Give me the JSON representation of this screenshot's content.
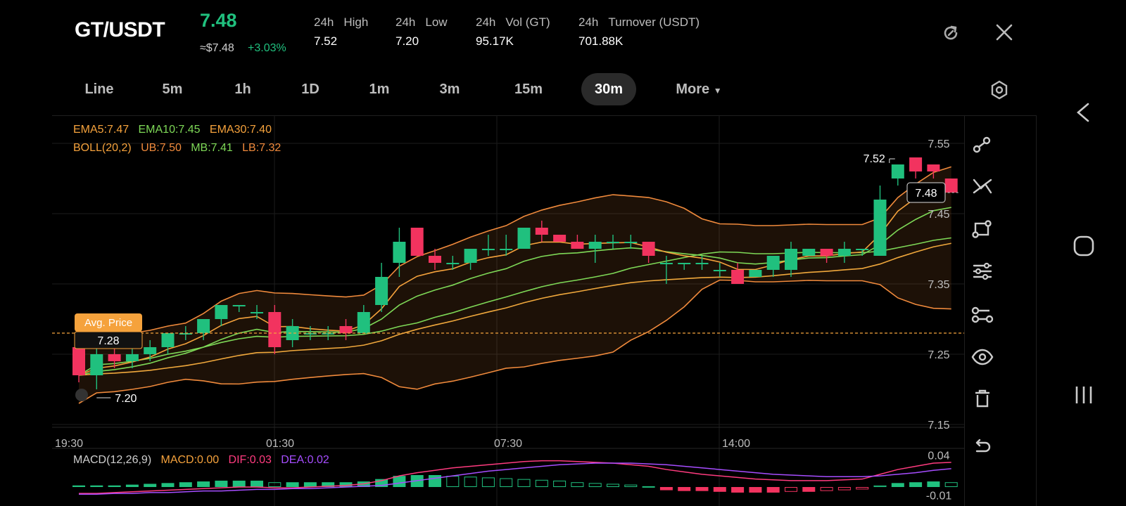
{
  "header": {
    "pair": "GT/USDT",
    "last_price": "7.48",
    "approx_usd": "≈$7.48",
    "change_pct": "+3.03%",
    "stats": [
      {
        "label_a": "24h",
        "label_b": "High",
        "value": "7.52"
      },
      {
        "label_a": "24h",
        "label_b": "Low",
        "value": "7.20"
      },
      {
        "label_a": "24h",
        "label_b": "Vol (GT)",
        "value": "95.17K"
      },
      {
        "label_a": "24h",
        "label_b": "Turnover (USDT)",
        "value": "701.88K"
      }
    ]
  },
  "tabs": [
    "Line",
    "5m",
    "1h",
    "1D",
    "1m",
    "3m",
    "15m",
    "30m",
    "More"
  ],
  "active_tab": "30m",
  "indicators": {
    "ema5": "EMA5:7.47",
    "ema10": "EMA10:7.45",
    "ema30": "EMA30:7.40",
    "boll": "BOLL(20,2)",
    "ub": "UB:7.50",
    "mb": "MB:7.41",
    "lb": "LB:7.32",
    "macd_name": "MACD(12,26,9)",
    "macd": "MACD:0.00",
    "dif": "DIF:0.03",
    "dea": "DEA:0.02"
  },
  "price_axis": [
    "7.55",
    "7.45",
    "7.35",
    "7.25",
    "7.15"
  ],
  "time_axis": [
    "19:30",
    "01:30",
    "07:30",
    "14:00"
  ],
  "macd_axis": [
    "0.04",
    "-0.01"
  ],
  "avg_price": {
    "label": "Avg. Price",
    "value": "7.28"
  },
  "high_marker": "7.52",
  "low_marker": "7.20",
  "last_marker": "7.48",
  "colors": {
    "up": "#20c07e",
    "down": "#f2335f",
    "ema5": "#f5a23c",
    "ema10": "#7ed957",
    "ema30": "#f0a83c",
    "boll": "#f08a3c",
    "dif": "#ff3b7f",
    "dea": "#a64dff"
  },
  "chart_data": {
    "type": "candlestick",
    "ylim": [
      7.15,
      7.58
    ],
    "candles": [
      {
        "o": 7.26,
        "h": 7.27,
        "l": 7.21,
        "c": 7.22
      },
      {
        "o": 7.22,
        "h": 7.27,
        "l": 7.2,
        "c": 7.25
      },
      {
        "o": 7.25,
        "h": 7.26,
        "l": 7.23,
        "c": 7.24
      },
      {
        "o": 7.24,
        "h": 7.26,
        "l": 7.23,
        "c": 7.25
      },
      {
        "o": 7.25,
        "h": 7.27,
        "l": 7.24,
        "c": 7.26
      },
      {
        "o": 7.26,
        "h": 7.28,
        "l": 7.25,
        "c": 7.28
      },
      {
        "o": 7.28,
        "h": 7.29,
        "l": 7.27,
        "c": 7.28
      },
      {
        "o": 7.28,
        "h": 7.3,
        "l": 7.27,
        "c": 7.3
      },
      {
        "o": 7.3,
        "h": 7.32,
        "l": 7.29,
        "c": 7.32
      },
      {
        "o": 7.32,
        "h": 7.32,
        "l": 7.31,
        "c": 7.32
      },
      {
        "o": 7.31,
        "h": 7.32,
        "l": 7.3,
        "c": 7.31
      },
      {
        "o": 7.31,
        "h": 7.32,
        "l": 7.25,
        "c": 7.26
      },
      {
        "o": 7.27,
        "h": 7.3,
        "l": 7.26,
        "c": 7.29
      },
      {
        "o": 7.28,
        "h": 7.29,
        "l": 7.27,
        "c": 7.28
      },
      {
        "o": 7.28,
        "h": 7.29,
        "l": 7.27,
        "c": 7.28
      },
      {
        "o": 7.29,
        "h": 7.3,
        "l": 7.27,
        "c": 7.28
      },
      {
        "o": 7.28,
        "h": 7.32,
        "l": 7.28,
        "c": 7.31
      },
      {
        "o": 7.32,
        "h": 7.38,
        "l": 7.31,
        "c": 7.36
      },
      {
        "o": 7.38,
        "h": 7.43,
        "l": 7.36,
        "c": 7.41
      },
      {
        "o": 7.43,
        "h": 7.43,
        "l": 7.39,
        "c": 7.39
      },
      {
        "o": 7.39,
        "h": 7.4,
        "l": 7.37,
        "c": 7.38
      },
      {
        "o": 7.38,
        "h": 7.39,
        "l": 7.37,
        "c": 7.38
      },
      {
        "o": 7.38,
        "h": 7.4,
        "l": 7.37,
        "c": 7.4
      },
      {
        "o": 7.4,
        "h": 7.42,
        "l": 7.39,
        "c": 7.4
      },
      {
        "o": 7.4,
        "h": 7.42,
        "l": 7.39,
        "c": 7.4
      },
      {
        "o": 7.4,
        "h": 7.43,
        "l": 7.4,
        "c": 7.43
      },
      {
        "o": 7.43,
        "h": 7.44,
        "l": 7.41,
        "c": 7.42
      },
      {
        "o": 7.42,
        "h": 7.42,
        "l": 7.41,
        "c": 7.41
      },
      {
        "o": 7.41,
        "h": 7.42,
        "l": 7.4,
        "c": 7.4
      },
      {
        "o": 7.4,
        "h": 7.42,
        "l": 7.38,
        "c": 7.41
      },
      {
        "o": 7.41,
        "h": 7.42,
        "l": 7.4,
        "c": 7.41
      },
      {
        "o": 7.41,
        "h": 7.42,
        "l": 7.4,
        "c": 7.41
      },
      {
        "o": 7.41,
        "h": 7.41,
        "l": 7.38,
        "c": 7.39
      },
      {
        "o": 7.38,
        "h": 7.39,
        "l": 7.35,
        "c": 7.38
      },
      {
        "o": 7.38,
        "h": 7.38,
        "l": 7.37,
        "c": 7.38
      },
      {
        "o": 7.38,
        "h": 7.39,
        "l": 7.37,
        "c": 7.38
      },
      {
        "o": 7.37,
        "h": 7.38,
        "l": 7.36,
        "c": 7.37
      },
      {
        "o": 7.37,
        "h": 7.38,
        "l": 7.35,
        "c": 7.35
      },
      {
        "o": 7.36,
        "h": 7.37,
        "l": 7.36,
        "c": 7.37
      },
      {
        "o": 7.37,
        "h": 7.39,
        "l": 7.36,
        "c": 7.39
      },
      {
        "o": 7.37,
        "h": 7.41,
        "l": 7.36,
        "c": 7.4
      },
      {
        "o": 7.39,
        "h": 7.4,
        "l": 7.39,
        "c": 7.4
      },
      {
        "o": 7.4,
        "h": 7.4,
        "l": 7.38,
        "c": 7.39
      },
      {
        "o": 7.39,
        "h": 7.41,
        "l": 7.38,
        "c": 7.4
      },
      {
        "o": 7.4,
        "h": 7.4,
        "l": 7.39,
        "c": 7.4
      },
      {
        "o": 7.39,
        "h": 7.49,
        "l": 7.39,
        "c": 7.47
      },
      {
        "o": 7.5,
        "h": 7.52,
        "l": 7.49,
        "c": 7.52
      },
      {
        "o": 7.53,
        "h": 7.53,
        "l": 7.5,
        "c": 7.51
      },
      {
        "o": 7.52,
        "h": 7.52,
        "l": 7.5,
        "c": 7.51
      },
      {
        "o": 7.5,
        "h": 7.5,
        "l": 7.48,
        "c": 7.48
      }
    ],
    "macd_hist": [
      0.002,
      0.002,
      0.002,
      0.003,
      0.004,
      0.005,
      0.006,
      0.007,
      0.008,
      0.008,
      0.008,
      0.006,
      0.006,
      0.006,
      0.006,
      0.006,
      0.007,
      0.01,
      0.014,
      0.015,
      0.015,
      0.014,
      0.013,
      0.012,
      0.011,
      0.01,
      0.009,
      0.008,
      0.006,
      0.005,
      0.004,
      0.003,
      0.001,
      -0.004,
      -0.005,
      -0.005,
      -0.006,
      -0.007,
      -0.007,
      -0.007,
      -0.006,
      -0.006,
      -0.005,
      -0.004,
      -0.003,
      0.002,
      0.005,
      0.006,
      0.007,
      0.006
    ],
    "dif": [
      -0.008,
      -0.008,
      -0.007,
      -0.006,
      -0.005,
      -0.004,
      -0.003,
      -0.002,
      -0.001,
      0.0,
      0.0,
      -0.001,
      -0.001,
      0.0,
      0.001,
      0.002,
      0.004,
      0.008,
      0.014,
      0.018,
      0.021,
      0.024,
      0.026,
      0.028,
      0.03,
      0.032,
      0.033,
      0.033,
      0.032,
      0.031,
      0.03,
      0.028,
      0.026,
      0.022,
      0.019,
      0.016,
      0.014,
      0.012,
      0.01,
      0.009,
      0.008,
      0.008,
      0.008,
      0.009,
      0.01,
      0.016,
      0.022,
      0.026,
      0.03,
      0.031
    ],
    "dea": [
      -0.009,
      -0.009,
      -0.008,
      -0.008,
      -0.007,
      -0.007,
      -0.006,
      -0.005,
      -0.005,
      -0.004,
      -0.003,
      -0.003,
      -0.002,
      -0.002,
      -0.001,
      0.0,
      0.001,
      0.002,
      0.005,
      0.008,
      0.011,
      0.014,
      0.017,
      0.02,
      0.022,
      0.024,
      0.026,
      0.028,
      0.029,
      0.03,
      0.03,
      0.03,
      0.029,
      0.028,
      0.026,
      0.024,
      0.022,
      0.02,
      0.018,
      0.016,
      0.015,
      0.014,
      0.013,
      0.013,
      0.013,
      0.014,
      0.016,
      0.018,
      0.021,
      0.023
    ],
    "macd_ylim": [
      -0.015,
      0.045
    ]
  }
}
